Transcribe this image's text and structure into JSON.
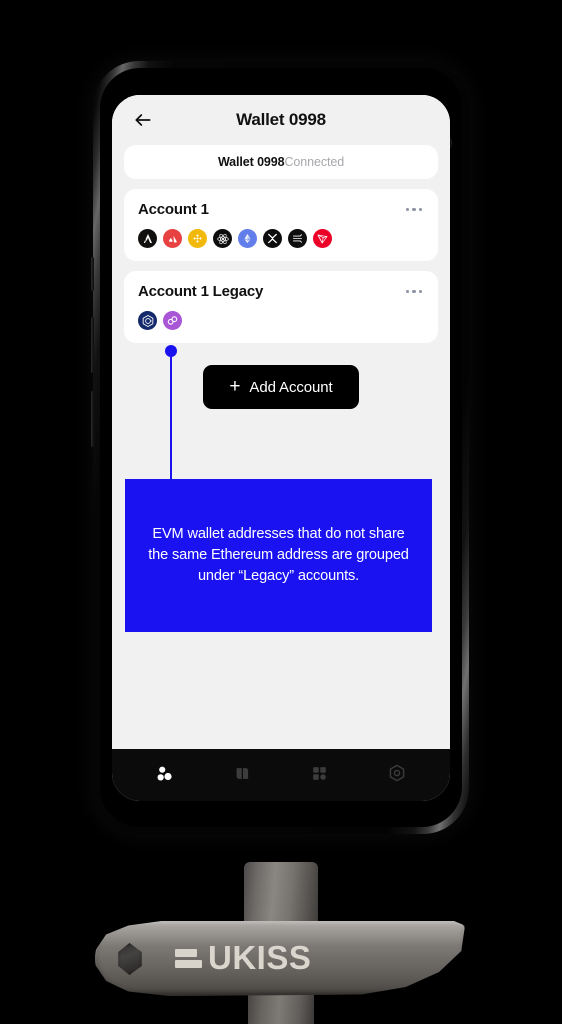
{
  "app": {
    "header": {
      "title": "Wallet 0998",
      "back_icon": "arrow-left-icon"
    },
    "connection": {
      "wallet_name": "Wallet 0998",
      "status": "Connected"
    },
    "accounts": [
      {
        "name": "Account 1",
        "menu_icon": "more-horizontal-icon",
        "chains": [
          {
            "id": "arbitrum",
            "label": "Arbitrum",
            "color": "#12100f",
            "fg": "#ffffff"
          },
          {
            "id": "avalanche",
            "label": "Avalanche",
            "color": "#e84142",
            "fg": "#ffffff"
          },
          {
            "id": "binance",
            "label": "BNB Chain",
            "color": "#f0b90b",
            "fg": "#ffffff"
          },
          {
            "id": "cosmos",
            "label": "Cosmos",
            "color": "#0d0d0d",
            "fg": "#ffffff"
          },
          {
            "id": "ethereum",
            "label": "Ethereum",
            "color": "#627eea",
            "fg": "#ffffff"
          },
          {
            "id": "xrp",
            "label": "XRP",
            "color": "#0d0d0d",
            "fg": "#ffffff"
          },
          {
            "id": "solana",
            "label": "Solana",
            "color": "#0d0d0d",
            "fg": "#ffffff"
          },
          {
            "id": "tron",
            "label": "TRON",
            "color": "#ed0027",
            "fg": "#ffffff"
          }
        ]
      },
      {
        "name": "Account 1 Legacy",
        "menu_icon": "more-horizontal-icon",
        "chains": [
          {
            "id": "cronos",
            "label": "Cronos",
            "color": "#14296b",
            "fg": "#ffffff"
          },
          {
            "id": "polygon",
            "label": "Polygon",
            "color": "#a855d6",
            "fg": "#ffffff"
          }
        ]
      }
    ],
    "add_account_button": {
      "label": "Add Account",
      "icon": "plus-icon"
    },
    "bottom_nav": [
      {
        "id": "accounts",
        "label": "Accounts",
        "icon": "accounts-icon",
        "active": true
      },
      {
        "id": "assets",
        "label": "Assets",
        "icon": "cards-icon",
        "active": false
      },
      {
        "id": "apps",
        "label": "Apps",
        "icon": "grid-icon",
        "active": false
      },
      {
        "id": "settings",
        "label": "Settings",
        "icon": "gear-icon",
        "active": false
      }
    ]
  },
  "callout": {
    "text": "EVM wallet addresses that do not share the same Ethereum address are grouped under “Legacy” accounts.",
    "color": "#1a12f0"
  },
  "device": {
    "brand": "UKISS",
    "logo_mark": "ukiss-bars-icon"
  },
  "theme": {
    "screen_bg": "#f1f1f1",
    "card_bg": "#ffffff",
    "text_primary": "#111111",
    "text_muted": "#a8a8ad",
    "accent": "#1a12f0",
    "button_bg": "#000000",
    "nav_bg": "#0b0b0b"
  }
}
